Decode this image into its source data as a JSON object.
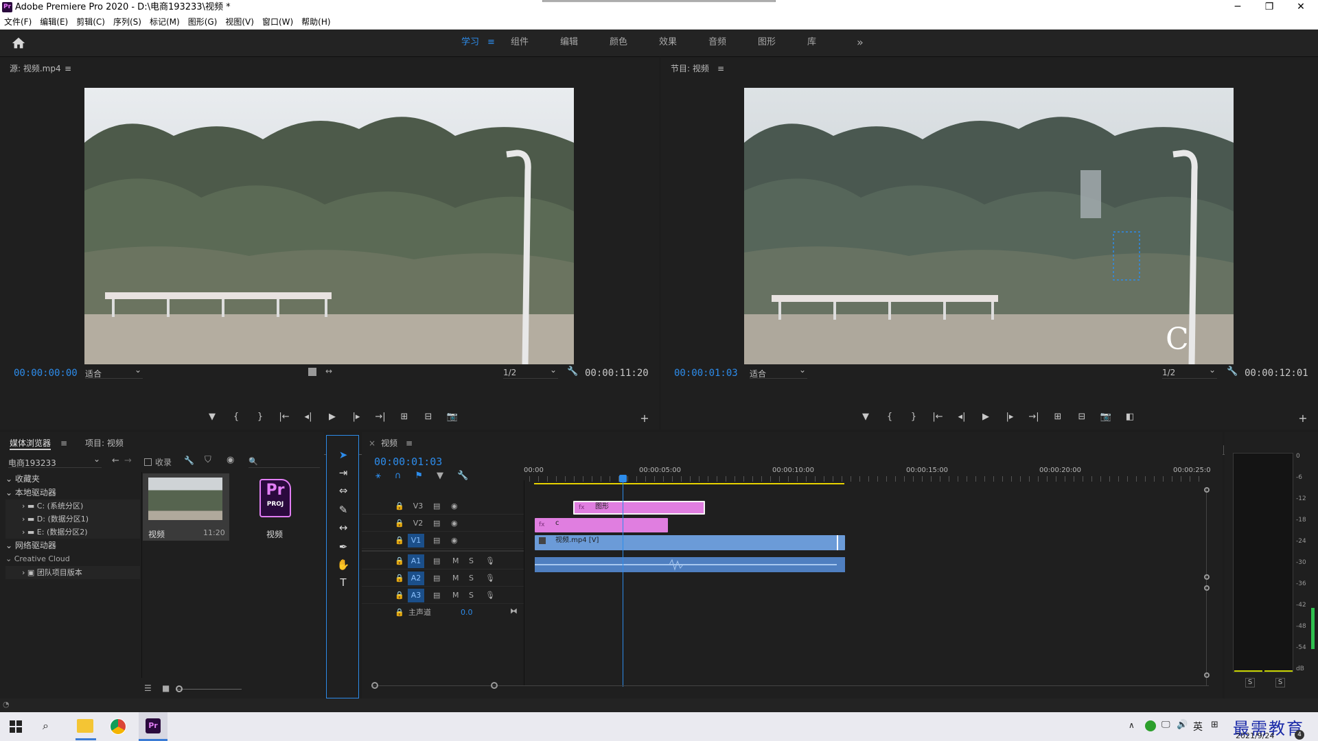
{
  "titlebar": {
    "logo": "Pr",
    "title": "Adobe Premiere Pro 2020 - D:\\电商193233\\视频 *",
    "minimize": "─",
    "restore": "❐",
    "close": "✕"
  },
  "menu": [
    "文件(F)",
    "编辑(E)",
    "剪辑(C)",
    "序列(S)",
    "标记(M)",
    "图形(G)",
    "视图(V)",
    "窗口(W)",
    "帮助(H)"
  ],
  "workspace": {
    "tabs": [
      "学习",
      "组件",
      "编辑",
      "颜色",
      "效果",
      "音频",
      "图形",
      "库"
    ],
    "active": "学习",
    "menu_glyph": "≡",
    "more": "»"
  },
  "source": {
    "title": "源: 视频.mp4",
    "menu": "≡",
    "timecode": "00:00:00:00",
    "fit": "适合",
    "quality": "1/2",
    "duration": "00:00:11:20"
  },
  "program": {
    "title": "节目: 视频",
    "menu": "≡",
    "timecode": "00:00:01:03",
    "fit": "适合",
    "quality": "1/2",
    "duration": "00:00:12:01",
    "overlay_letter": "C"
  },
  "controls": {
    "marker": "▼",
    "in": "{",
    "out": "}",
    "goin": "|←",
    "stepback": "◂|",
    "play": "▶",
    "stepfwd": "|▸",
    "goout": "→|",
    "insert": "⊞",
    "overwrite": "⊟",
    "export": "📷",
    "compare": "◧",
    "add": "+"
  },
  "media": {
    "tabs": [
      "媒体浏览器",
      "项目: 视频"
    ],
    "tab_menu": "≡",
    "location": "电商193233",
    "ingest": "收录",
    "search_icon": "🔍",
    "tree": [
      {
        "label": "收藏夹",
        "level": 0
      },
      {
        "label": "本地驱动器",
        "level": 0
      },
      {
        "label": "C: (系统分区)",
        "level": 1
      },
      {
        "label": "D: (数据分区1)",
        "level": 1
      },
      {
        "label": "E: (数据分区2)",
        "level": 1
      },
      {
        "label": "网络驱动器",
        "level": 0
      },
      {
        "label": "Creative Cloud",
        "level": 0
      },
      {
        "label": "团队项目版本",
        "level": 1
      }
    ],
    "files": [
      {
        "name": "视频",
        "duration": "11:20"
      },
      {
        "name": "视频",
        "badge": "Pr",
        "badge_sub": "PROJ"
      }
    ]
  },
  "timeline": {
    "tab": "视频",
    "close": "×",
    "menu": "≡",
    "timecode": "00:00:01:03",
    "ruler": [
      "00:00",
      "00:00:05:00",
      "00:00:10:00",
      "00:00:15:00",
      "00:00:20:00",
      "00:00:25:0"
    ],
    "tracks": [
      "V3",
      "V2",
      "V1",
      "A1",
      "A2",
      "A3"
    ],
    "master": "主声道",
    "master_val": "0.0",
    "clips": {
      "v3": "图形",
      "v2": "c",
      "v1": "视频.mp4 [V]",
      "fx": "fx"
    },
    "mute": "M",
    "solo": "S"
  },
  "meter": {
    "scale": [
      "0",
      "-6",
      "-12",
      "-18",
      "-24",
      "-30",
      "-36",
      "-42",
      "-48",
      "-54",
      "dB"
    ],
    "solo_l": "S",
    "solo_r": "S"
  },
  "taskbar": {
    "lang": "英",
    "date": "2021/9/24",
    "watermark": "最需教育",
    "badge": "4"
  },
  "colors": {
    "accent": "#2d8ceb",
    "clip_pink": "#e07ee0",
    "clip_blue": "#6b9bd8",
    "play_yellow": "#e8d300"
  }
}
